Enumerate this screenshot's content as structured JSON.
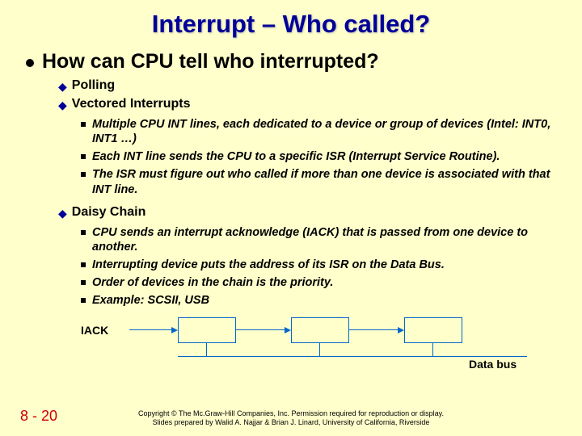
{
  "title": "Interrupt – Who called?",
  "main_bullet": "How can CPU tell who interrupted?",
  "sub": {
    "polling": "Polling",
    "vectored": "Vectored Interrupts",
    "vectored_items": {
      "a": "Multiple CPU INT lines, each dedicated to a device or group of devices (Intel: INT0, INT1 …)",
      "b": "Each INT line sends the CPU to a specific ISR (Interrupt Service Routine).",
      "c": "The ISR must figure out who called if more than one device is associated with that INT line."
    },
    "daisy": "Daisy Chain",
    "daisy_items": {
      "a": "CPU sends an interrupt acknowledge (IACK) that is passed from one device to another.",
      "b": "Interrupting device puts the address of its ISR on the Data Bus.",
      "c": "Order of devices in the chain is the priority.",
      "d": "Example: SCSII, USB"
    }
  },
  "diagram": {
    "iack": "IACK",
    "databus": "Data bus"
  },
  "footer": {
    "slide_number": "8 - 20",
    "copyright_line1": "Copyright © The Mc.Graw-Hill Companies, Inc. Permission required for reproduction or display.",
    "copyright_line2": "Slides prepared by Walid A. Najjar & Brian J. Linard, University of California, Riverside"
  }
}
